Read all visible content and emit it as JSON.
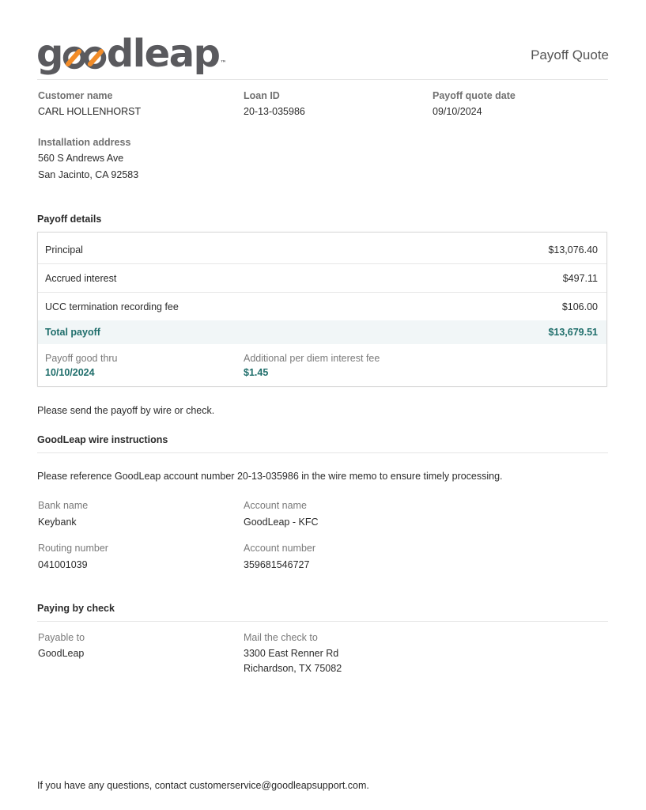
{
  "header": {
    "logo_text_start": "g",
    "logo_text_end": "dleap",
    "logo_tm": "™",
    "title": "Payoff Quote"
  },
  "customer": {
    "name_label": "Customer name",
    "name_value": "CARL HOLLENHORST",
    "loan_label": "Loan ID",
    "loan_value": "20-13-035986",
    "date_label": "Payoff quote date",
    "date_value": "09/10/2024",
    "address_label": "Installation address",
    "address_line1": "560 S Andrews Ave",
    "address_line2": "San Jacinto, CA 92583"
  },
  "payoff": {
    "heading": "Payoff details",
    "rows": [
      {
        "label": "Principal",
        "amount": "$13,076.40"
      },
      {
        "label": "Accrued interest",
        "amount": "$497.11"
      },
      {
        "label": "UCC termination recording fee",
        "amount": "$106.00"
      }
    ],
    "total_label": "Total payoff",
    "total_amount": "$13,679.51",
    "good_thru_label": "Payoff good thru",
    "good_thru_value": "10/10/2024",
    "per_diem_label": "Additional per diem interest fee",
    "per_diem_value": "$1.45"
  },
  "send_note": "Please send the payoff by wire or check.",
  "wire": {
    "heading": "GoodLeap wire instructions",
    "reference_note": "Please reference GoodLeap account number 20-13-035986 in the wire memo to ensure timely processing.",
    "bank_name_label": "Bank name",
    "bank_name_value": "Keybank",
    "account_name_label": "Account name",
    "account_name_value": "GoodLeap - KFC",
    "routing_label": "Routing number",
    "routing_value": "041001039",
    "account_number_label": "Account number",
    "account_number_value": "359681546727"
  },
  "check": {
    "heading": "Paying by check",
    "payable_label": "Payable to",
    "payable_value": "GoodLeap",
    "mail_label": "Mail the check to",
    "mail_line1": "3300 East Renner Rd",
    "mail_line2": "Richardson, TX 75082"
  },
  "footer": {
    "contact": "If you have any questions, contact customerservice@goodleapsupport.com."
  },
  "colors": {
    "accent_teal": "#1f6e6b",
    "logo_gray": "#5a5a5e",
    "logo_orange": "#f28c28"
  }
}
